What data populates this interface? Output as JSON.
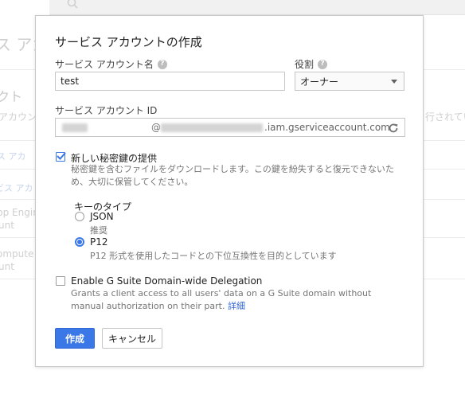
{
  "background": {
    "title_fragment": "ス アカ",
    "heading_fragment": "クト",
    "subtext_left": "アカウン",
    "subtext_right": "行されてい",
    "row_link": "ス アカ",
    "row_link2": "ビス アカ",
    "row1_line1": "pp Engin",
    "row1_line2": "unt",
    "row2_line1": "ompute E",
    "row2_line2": "unt"
  },
  "dialog": {
    "title": "サービス アカウントの作成",
    "account_name": {
      "label": "サービス アカウント名",
      "value": "test"
    },
    "role": {
      "label": "役割",
      "selected": "オーナー"
    },
    "account_id": {
      "label": "サービス アカウント ID",
      "at": "@",
      "domain_suffix": ".iam.gserviceaccount.com"
    },
    "new_key": {
      "checked": true,
      "label": "新しい秘密鍵の提供",
      "description": "秘密鍵を含むファイルをダウンロードします。この鍵を紛失すると復元できないため、大切に保管してください。"
    },
    "key_type": {
      "label": "キーのタイプ",
      "options": [
        {
          "label": "JSON",
          "sub": "推奨",
          "checked": false
        },
        {
          "label": "P12",
          "sub": "P12 形式を使用したコードとの下位互換性を目的としています",
          "checked": true
        }
      ]
    },
    "gsuite": {
      "checked": false,
      "label": "Enable G Suite Domain-wide Delegation",
      "description": "Grants a client access to all users' data on a G Suite domain without manual authorization on their part.",
      "details_link": "詳細"
    },
    "buttons": {
      "create": "作成",
      "cancel": "キャンセル"
    }
  },
  "colors": {
    "accent": "#3b78e7",
    "link": "#3367d6"
  }
}
